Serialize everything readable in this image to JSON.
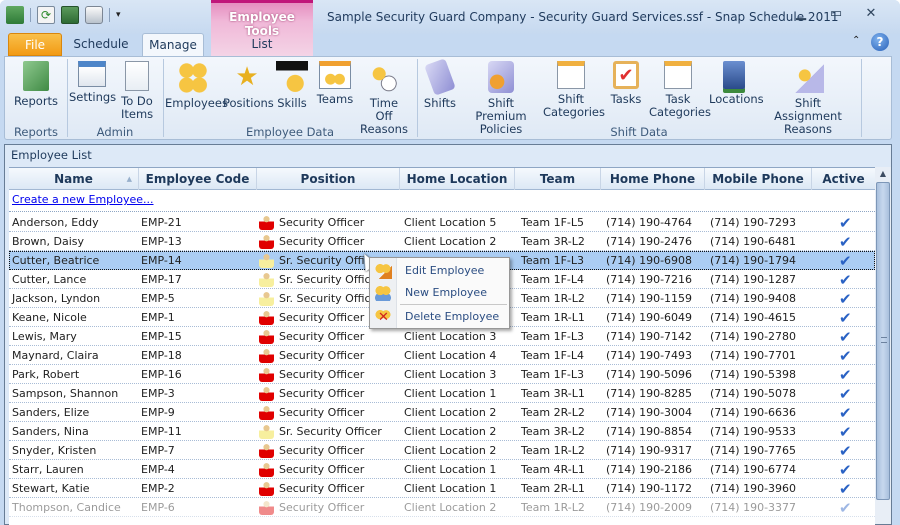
{
  "window": {
    "title": "Sample Security Guard Company - Security Guard Services.ssf - Snap Schedule 2011",
    "minimize": "minimize",
    "maximize": "maximize",
    "close": "close"
  },
  "quick_access": {
    "icons": [
      "app-icon",
      "refresh-icon",
      "copy-icon",
      "print-icon",
      "customize-dropdown-icon"
    ]
  },
  "contextual_tab_group": {
    "label": "Employee Tools"
  },
  "tabs": [
    {
      "label": "File",
      "active": false
    },
    {
      "label": "Schedule",
      "active": false
    },
    {
      "label": "Manage",
      "active": true
    },
    {
      "label": "List",
      "active": false
    }
  ],
  "ribbon": {
    "groups": [
      {
        "label": "Reports",
        "buttons": [
          {
            "label": "Reports",
            "icon": "reports-icon"
          }
        ]
      },
      {
        "label": "Admin",
        "buttons": [
          {
            "label": "Settings",
            "icon": "settings-icon"
          },
          {
            "label": "To Do Items",
            "icon": "todo-icon"
          }
        ]
      },
      {
        "label": "Employee Data",
        "buttons": [
          {
            "label": "Employees",
            "icon": "employees-icon"
          },
          {
            "label": "Positions",
            "icon": "positions-icon"
          },
          {
            "label": "Skills",
            "icon": "skills-icon"
          },
          {
            "label": "Teams",
            "icon": "teams-icon"
          },
          {
            "label": "Time Off Reasons",
            "icon": "time-off-icon"
          }
        ]
      },
      {
        "label": "Shift Data",
        "buttons": [
          {
            "label": "Shifts",
            "icon": "shifts-icon"
          },
          {
            "label": "Shift Premium Policies",
            "icon": "shift-premium-icon"
          },
          {
            "label": "Shift Categories",
            "icon": "shift-categories-icon"
          },
          {
            "label": "Tasks",
            "icon": "tasks-icon"
          },
          {
            "label": "Task Categories",
            "icon": "task-categories-icon"
          },
          {
            "label": "Locations",
            "icon": "locations-icon"
          },
          {
            "label": "Shift Assignment Reasons",
            "icon": "shift-assignment-icon"
          }
        ]
      }
    ]
  },
  "employee_list": {
    "title": "Employee List",
    "create_link": "Create a new Employee...",
    "columns": [
      "Name",
      "Employee Code",
      "Position",
      "Home Location",
      "Team",
      "Home Phone",
      "Mobile Phone",
      "Active"
    ],
    "sort_column": "Name",
    "rows": [
      {
        "name": "Anderson, Eddy",
        "code": "EMP-21",
        "position": "Security Officer",
        "location": "Client Location 5",
        "team": "Team 1F-L5",
        "home": "(714) 190-4764",
        "mobile": "(714) 190-7293",
        "active": true
      },
      {
        "name": "Brown, Daisy",
        "code": "EMP-13",
        "position": "Security Officer",
        "location": "Client Location 2",
        "team": "Team 3R-L2",
        "home": "(714) 190-2476",
        "mobile": "(714) 190-6481",
        "active": true
      },
      {
        "name": "Cutter, Beatrice",
        "code": "EMP-14",
        "position": "Sr. Security Officer",
        "location": "",
        "team": "Team 1F-L3",
        "home": "(714) 190-6908",
        "mobile": "(714) 190-1794",
        "active": true,
        "selected": true
      },
      {
        "name": "Cutter, Lance",
        "code": "EMP-17",
        "position": "Sr. Security Officer",
        "location": "",
        "team": "Team 1F-L4",
        "home": "(714) 190-7216",
        "mobile": "(714) 190-1287",
        "active": true
      },
      {
        "name": "Jackson, Lyndon",
        "code": "EMP-5",
        "position": "Sr. Security Officer",
        "location": "",
        "team": "Team 1R-L2",
        "home": "(714) 190-1159",
        "mobile": "(714) 190-9408",
        "active": true
      },
      {
        "name": "Keane, Nicole",
        "code": "EMP-1",
        "position": "Security Officer",
        "location": "",
        "team": "Team 1R-L1",
        "home": "(714) 190-6049",
        "mobile": "(714) 190-4615",
        "active": true
      },
      {
        "name": "Lewis, Mary",
        "code": "EMP-15",
        "position": "Security Officer",
        "location": "Client Location 3",
        "team": "Team 1F-L3",
        "home": "(714) 190-7142",
        "mobile": "(714) 190-2780",
        "active": true
      },
      {
        "name": "Maynard, Claira",
        "code": "EMP-18",
        "position": "Security Officer",
        "location": "Client Location 4",
        "team": "Team 1F-L4",
        "home": "(714) 190-7493",
        "mobile": "(714) 190-7701",
        "active": true
      },
      {
        "name": "Park, Robert",
        "code": "EMP-16",
        "position": "Security Officer",
        "location": "Client Location 3",
        "team": "Team 1F-L3",
        "home": "(714) 190-5096",
        "mobile": "(714) 190-5398",
        "active": true
      },
      {
        "name": "Sampson, Shannon",
        "code": "EMP-3",
        "position": "Security Officer",
        "location": "Client Location 1",
        "team": "Team 3R-L1",
        "home": "(714) 190-8285",
        "mobile": "(714) 190-5078",
        "active": true
      },
      {
        "name": "Sanders, Elize",
        "code": "EMP-9",
        "position": "Security Officer",
        "location": "Client Location 2",
        "team": "Team 2R-L2",
        "home": "(714) 190-3004",
        "mobile": "(714) 190-6636",
        "active": true
      },
      {
        "name": "Sanders, Nina",
        "code": "EMP-11",
        "position": "Sr. Security Officer",
        "location": "Client Location 2",
        "team": "Team 3R-L2",
        "home": "(714) 190-8854",
        "mobile": "(714) 190-9533",
        "active": true
      },
      {
        "name": "Snyder, Kristen",
        "code": "EMP-7",
        "position": "Security Officer",
        "location": "Client Location 2",
        "team": "Team 1R-L2",
        "home": "(714) 190-9317",
        "mobile": "(714) 190-7765",
        "active": true
      },
      {
        "name": "Starr, Lauren",
        "code": "EMP-4",
        "position": "Security Officer",
        "location": "Client Location 1",
        "team": "Team 4R-L1",
        "home": "(714) 190-2186",
        "mobile": "(714) 190-6774",
        "active": true
      },
      {
        "name": "Stewart, Katie",
        "code": "EMP-2",
        "position": "Security Officer",
        "location": "Client Location 1",
        "team": "Team 2R-L1",
        "home": "(714) 190-1172",
        "mobile": "(714) 190-3960",
        "active": true
      },
      {
        "name": "Thompson, Candice",
        "code": "EMP-6",
        "position": "Security Officer",
        "location": "Client Location 2",
        "team": "Team 1R-L2",
        "home": "(714) 190-2009",
        "mobile": "(714) 190-3377",
        "active": true
      }
    ]
  },
  "context_menu": {
    "items": [
      {
        "label": "Edit Employee",
        "icon": "edit-employee-icon"
      },
      {
        "label": "New Employee",
        "icon": "new-employee-icon"
      },
      {
        "label": "Delete Employee",
        "icon": "delete-employee-icon"
      }
    ]
  },
  "colors": {
    "file_tab": "#f29a14",
    "contextual_accent": "#c0167a",
    "selected_row": "#abcdf3",
    "link": "#0000ee",
    "security_officer_icon": "#e00000",
    "sr_security_officer_icon": "#f7ef9e",
    "check": "#2a62c4"
  }
}
